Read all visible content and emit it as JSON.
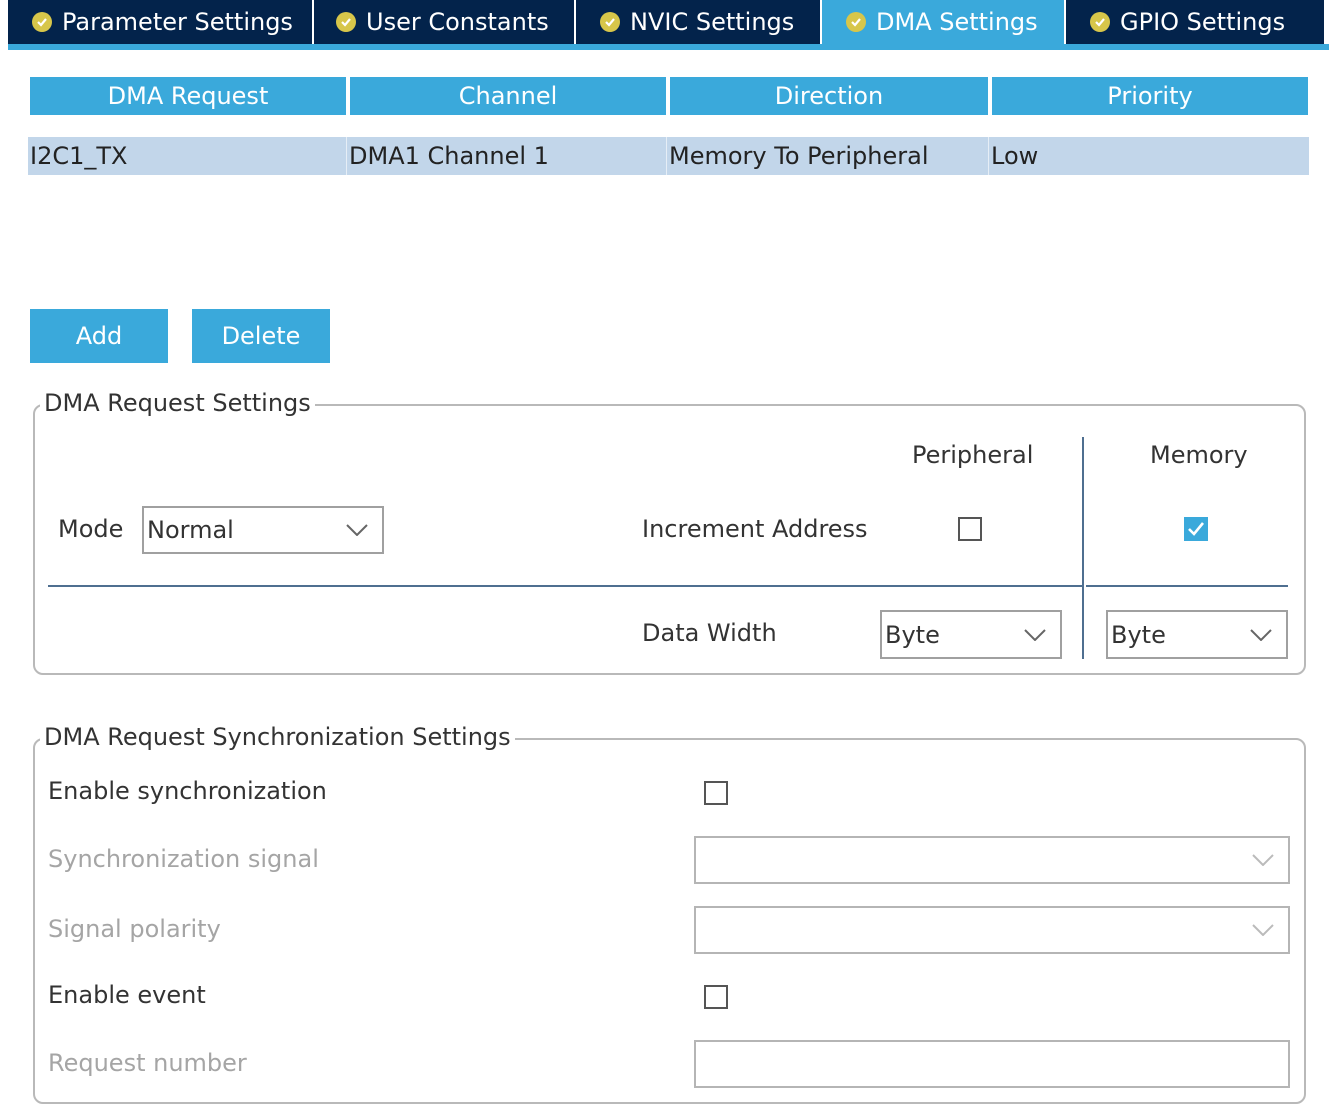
{
  "tabs": [
    {
      "label": "Parameter Settings",
      "active": false
    },
    {
      "label": "User Constants",
      "active": false
    },
    {
      "label": "NVIC Settings",
      "active": false
    },
    {
      "label": "DMA Settings",
      "active": true
    },
    {
      "label": "GPIO Settings",
      "active": false
    }
  ],
  "table": {
    "headers": [
      "DMA Request",
      "Channel",
      "Direction",
      "Priority"
    ],
    "rows": [
      [
        "I2C1_TX",
        "DMA1 Channel 1",
        "Memory To Peripheral",
        "Low"
      ]
    ]
  },
  "buttons": {
    "add": "Add",
    "delete": "Delete"
  },
  "request_settings": {
    "legend": "DMA Request Settings",
    "peripheral_header": "Peripheral",
    "memory_header": "Memory",
    "mode_label": "Mode",
    "mode_value": "Normal",
    "increment_label": "Increment Address",
    "peripheral_increment": false,
    "memory_increment": true,
    "data_width_label": "Data Width",
    "peripheral_width": "Byte",
    "memory_width": "Byte"
  },
  "sync_settings": {
    "legend": "DMA Request Synchronization Settings",
    "enable_sync_label": "Enable synchronization",
    "enable_sync": false,
    "sync_signal_label": "Synchronization signal",
    "sync_signal_value": "",
    "signal_polarity_label": "Signal polarity",
    "signal_polarity_value": "",
    "enable_event_label": "Enable event",
    "enable_event": false,
    "request_number_label": "Request number",
    "request_number_value": ""
  },
  "colors": {
    "tab_bg": "#03234b",
    "accent": "#3aa9db",
    "selected_row": "#c2d6ea",
    "check_badge": "#d7c64a"
  }
}
